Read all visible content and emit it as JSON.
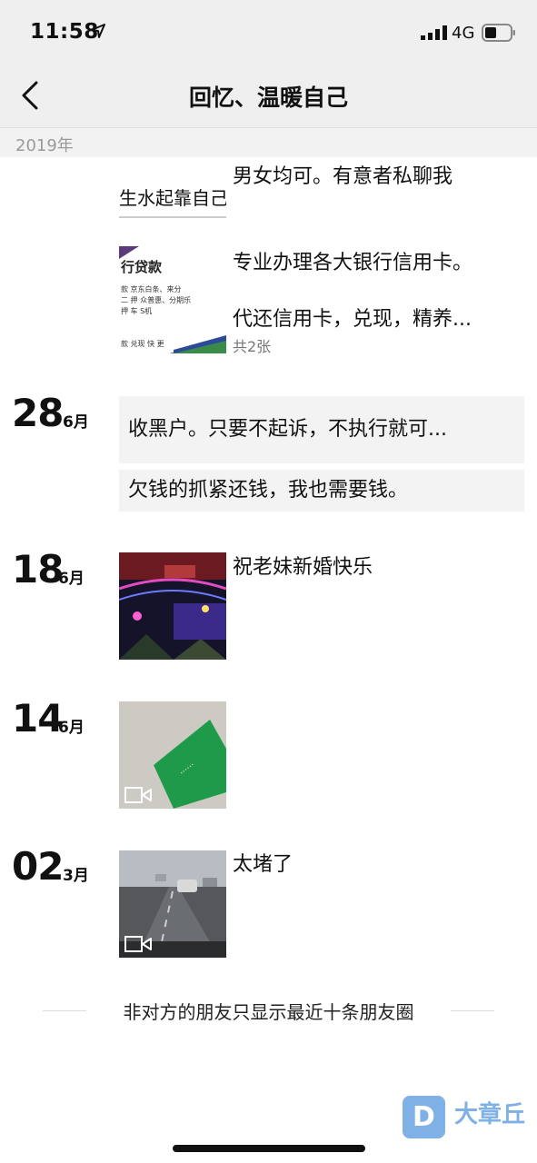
{
  "status": {
    "time": "11:58",
    "network": "4G"
  },
  "nav": {
    "title": "回忆、温暖自己"
  },
  "year": "2019年",
  "posts_top": [
    {
      "text": "男女均可。有意者私聊我"
    },
    {
      "line1": "专业办理各大银行信用卡。",
      "line2": "代还信用卡，兑现，精养...",
      "count": "共2张"
    }
  ],
  "thumb_texts": {
    "logo_text": "生水起靠自己",
    "loan_title": "行贷款",
    "loan_lines": [
      "款  京东白条、来分",
      "二 押  众普惠、分期乐",
      "押 车  S机",
      "款 兑现  快 更"
    ]
  },
  "dates": [
    {
      "day": "28",
      "month": "6月"
    },
    {
      "day": "18",
      "month": "6月"
    },
    {
      "day": "14",
      "month": "6月"
    },
    {
      "day": "02",
      "month": "3月"
    }
  ],
  "cards": [
    "收黑户。只要不起诉，不执行就可...",
    "欠钱的抓紧还钱，我也需要钱。"
  ],
  "post_wedding": "祝老妹新婚快乐",
  "post_traffic": "太堵了",
  "footer": "非对方的朋友只显示最近十条朋友圈",
  "watermark": {
    "letter": "D",
    "text": "大章丘"
  }
}
